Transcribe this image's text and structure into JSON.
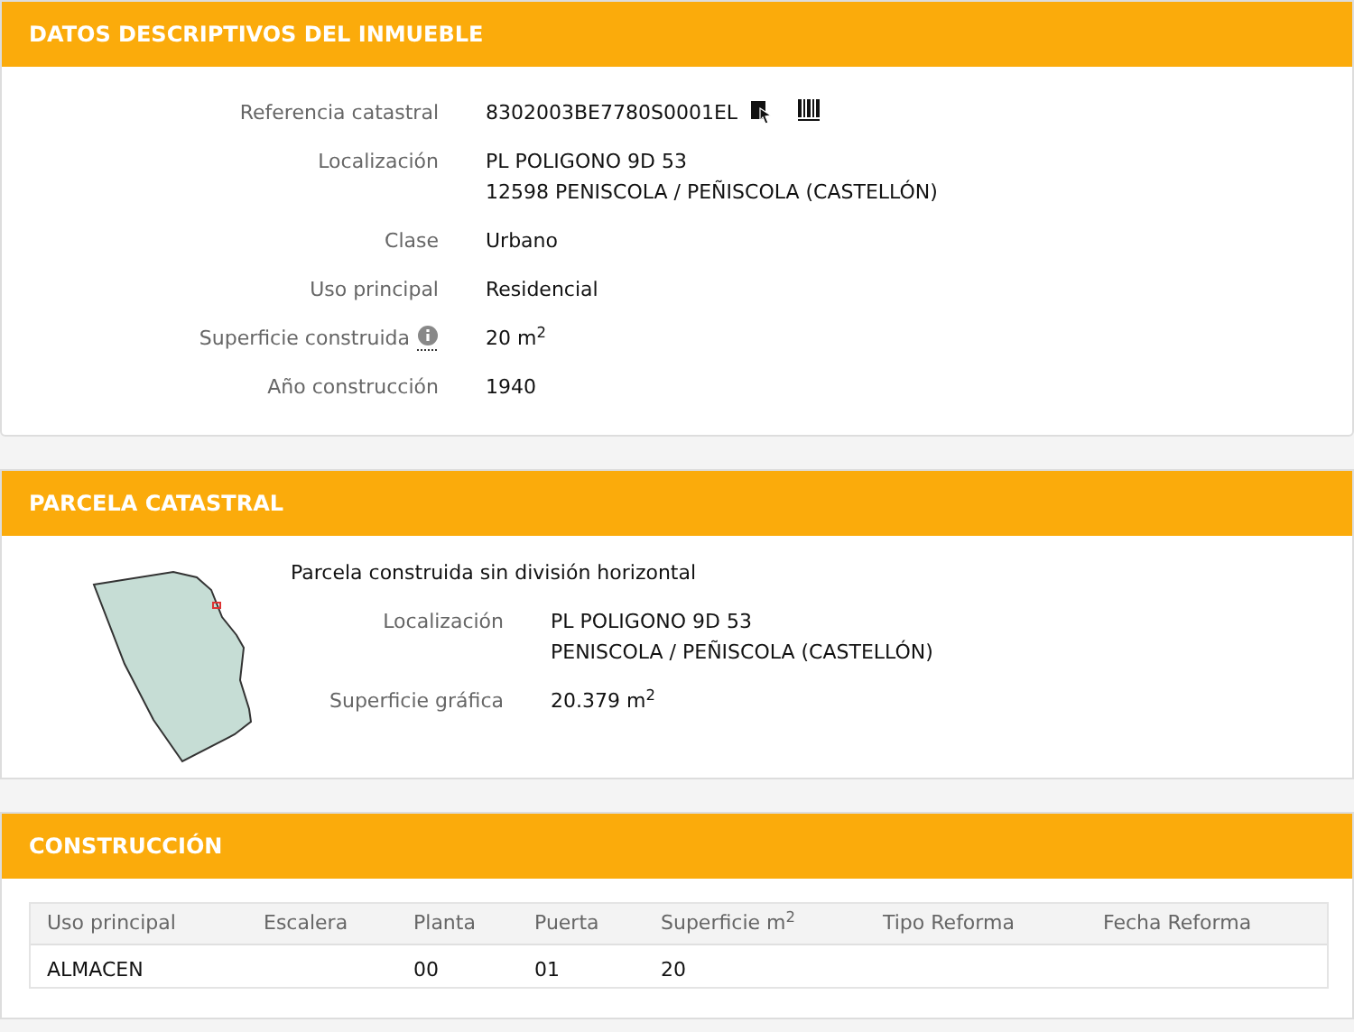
{
  "inmueble": {
    "title": "DATOS DESCRIPTIVOS DEL INMUEBLE",
    "fields": [
      {
        "label": "Referencia catastral",
        "lines": [
          "8302003BE7780S0001EL"
        ],
        "kind": "reference"
      },
      {
        "label": "Localización",
        "lines": [
          "PL POLIGONO 9D 53",
          "12598 PENISCOLA / PEÑISCOLA (CASTELLÓN)"
        ]
      },
      {
        "label": "Clase",
        "lines": [
          "Urbano"
        ]
      },
      {
        "label": "Uso principal",
        "lines": [
          "Residencial"
        ]
      },
      {
        "label": "Superficie construida",
        "lines": [
          "20 m$^{2}$"
        ],
        "kind": "info"
      },
      {
        "label": "Año construcción",
        "lines": [
          "1940"
        ]
      }
    ]
  },
  "parcela": {
    "title": "PARCELA CATASTRAL",
    "description": "Parcela construida sin división horizontal",
    "fields": [
      {
        "label": "Localización",
        "lines": [
          "PL POLIGONO 9D 53",
          "PENISCOLA / PEÑISCOLA (CASTELLÓN)"
        ]
      },
      {
        "label": "Superficie gráfica",
        "lines": [
          "20.379 m$^{2}$"
        ]
      }
    ]
  },
  "construccion": {
    "title": "CONSTRUCCIÓN",
    "columns": [
      "Uso principal",
      "Escalera",
      "Planta",
      "Puerta",
      "Superficie m$^{2}$",
      "Tipo Reforma",
      "Fecha Reforma"
    ],
    "rows": [
      [
        "ALMACEN",
        "",
        "00",
        "01",
        "20",
        "",
        ""
      ]
    ]
  }
}
